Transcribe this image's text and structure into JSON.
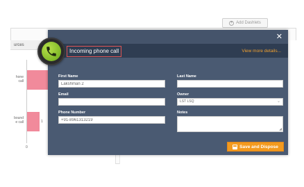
{
  "background": {
    "add_dashlets_label": "Add Dashlets",
    "panel_header": "urces",
    "rows": [
      {
        "label_line1": "hone",
        "label_line2": "call",
        "count": ""
      },
      {
        "label_line1": "bound",
        "label_line2": "e call",
        "count": "1"
      }
    ],
    "axis_zero": "0",
    "bar_color": "#f18a9b"
  },
  "modal": {
    "close_glyph": "✕",
    "title": "Incoming phone call",
    "view_more": "View more details...",
    "accent_color": "#f39a1e",
    "fields": {
      "first_name": {
        "label": "First Name",
        "value": "Lakshman 2"
      },
      "last_name": {
        "label": "Last Name",
        "value": ""
      },
      "email": {
        "label": "Email",
        "value": ""
      },
      "owner": {
        "label": "Owner",
        "value": "LST LSQ"
      },
      "phone": {
        "label": "Phone Number",
        "value": "+91-8961313219"
      },
      "notes": {
        "label": "Notes",
        "value": ""
      }
    },
    "save_label": "Save and Dispose"
  },
  "icons": {
    "phone": "phone-icon",
    "close": "close-icon",
    "save": "save-icon",
    "add": "add-icon",
    "chevron": "chevron-down-icon"
  }
}
